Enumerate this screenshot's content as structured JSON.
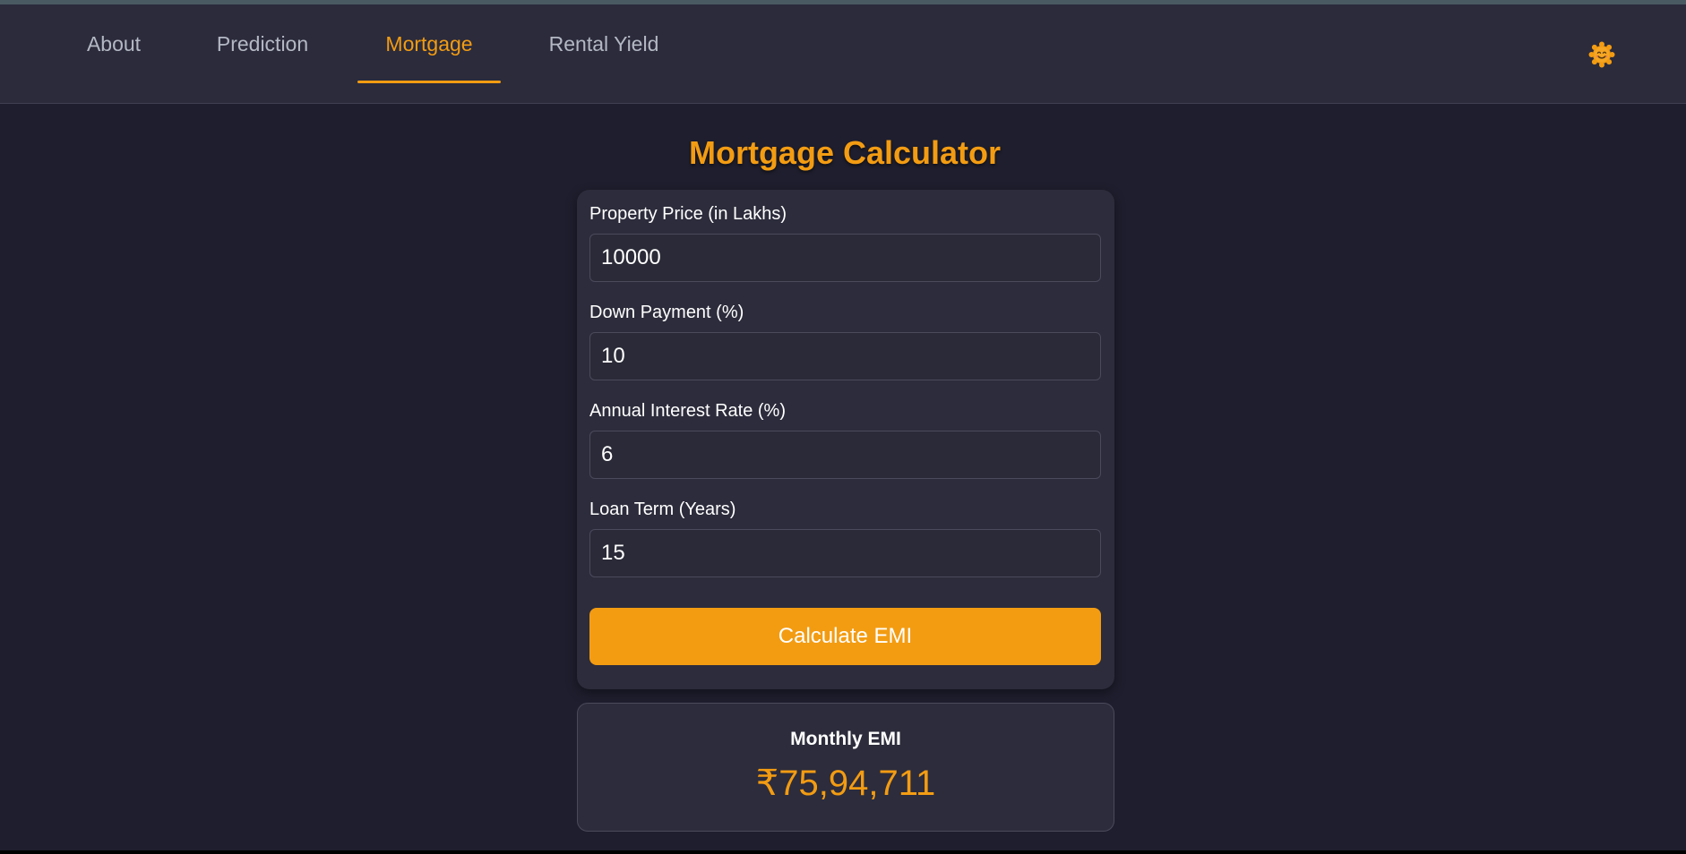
{
  "nav": {
    "tabs": [
      {
        "label": "About",
        "active": false
      },
      {
        "label": "Prediction",
        "active": false
      },
      {
        "label": "Mortgage",
        "active": true
      },
      {
        "label": "Rental Yield",
        "active": false
      }
    ],
    "theme_toggle_icon": "sun-smiley-icon"
  },
  "page": {
    "title": "Mortgage Calculator"
  },
  "form": {
    "fields": [
      {
        "label": "Property Price (in Lakhs)",
        "value": "10000"
      },
      {
        "label": "Down Payment (%)",
        "value": "10"
      },
      {
        "label": "Annual Interest Rate (%)",
        "value": "6"
      },
      {
        "label": "Loan Term (Years)",
        "value": "15"
      }
    ],
    "submit_label": "Calculate EMI"
  },
  "result": {
    "label": "Monthly EMI",
    "value": "₹75,94,711"
  },
  "colors": {
    "accent": "#f39c12",
    "background": "#1e1e2e",
    "navbar": "#2b2b3c",
    "card": "#2c2c3c"
  }
}
